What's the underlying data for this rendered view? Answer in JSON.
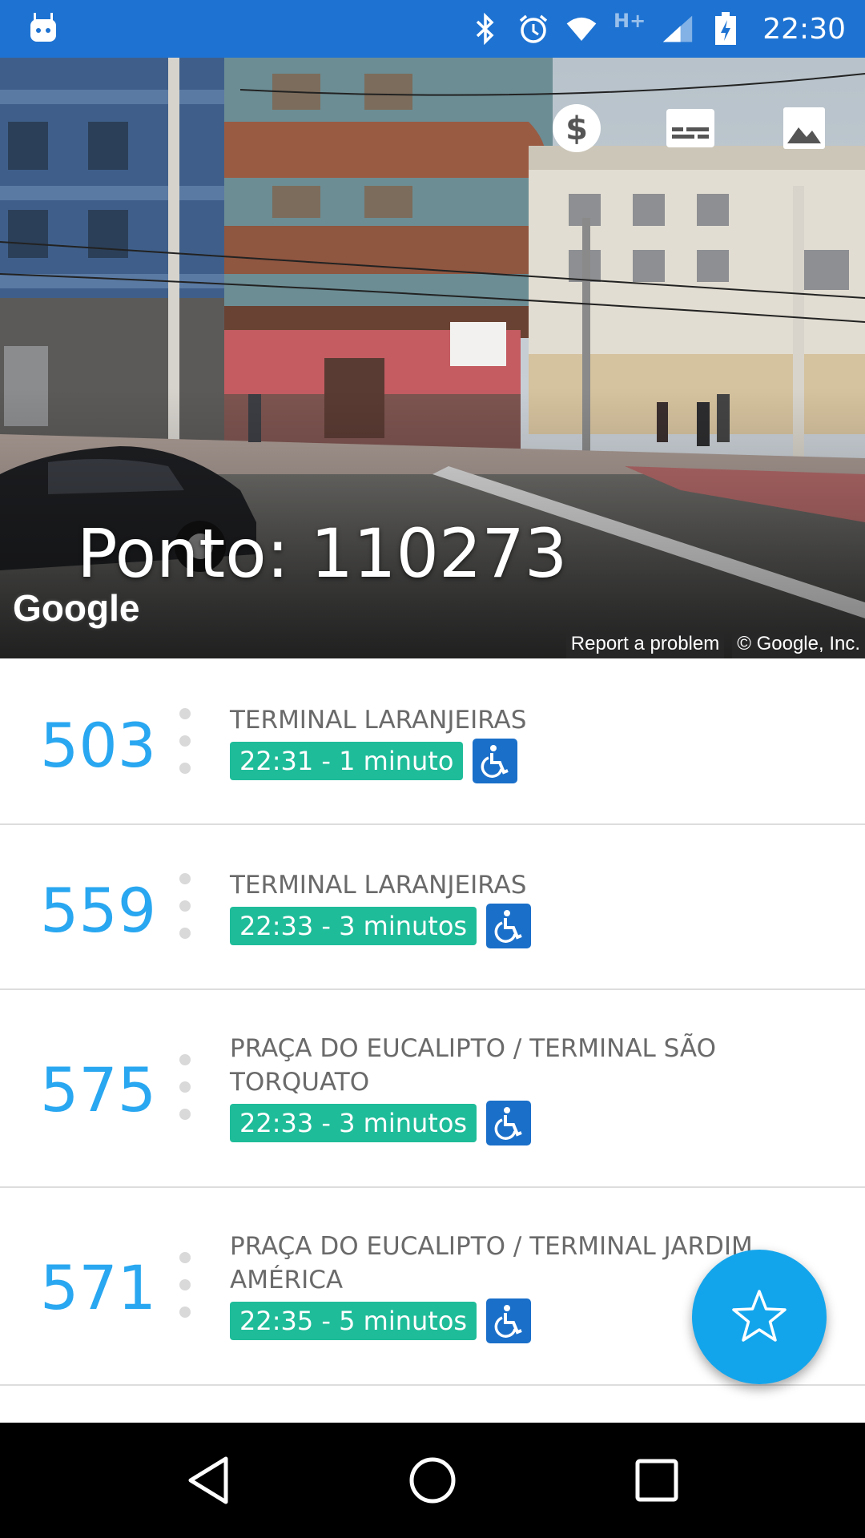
{
  "status_bar": {
    "time": "22:30",
    "network_label": "H+",
    "icons": [
      "android-icon",
      "bluetooth-icon",
      "alarm-icon",
      "wifi-icon",
      "signal-icon",
      "battery-charging-icon"
    ]
  },
  "header": {
    "stop_title": "Ponto: 110273",
    "google_logo": "Google",
    "report_label": "Report a problem",
    "copyright_label": "© Google, Inc.",
    "actions": [
      "fare-icon",
      "card-icon",
      "image-icon"
    ]
  },
  "arrivals": [
    {
      "line": "503",
      "destination": "TERMINAL LARANJEIRAS",
      "eta": "22:31 - 1 minuto",
      "accessible": true
    },
    {
      "line": "559",
      "destination": "TERMINAL LARANJEIRAS",
      "eta": "22:33 - 3 minutos",
      "accessible": true
    },
    {
      "line": "575",
      "destination": "PRAÇA DO EUCALIPTO / TERMINAL SÃO TORQUATO",
      "eta": "22:33 - 3 minutos",
      "accessible": true
    },
    {
      "line": "571",
      "destination": "PRAÇA DO EUCALIPTO / TERMINAL JARDIM AMÉRICA",
      "eta": "22:35 - 5 minutos",
      "accessible": true
    }
  ],
  "fab": {
    "icon": "star-outline-icon"
  },
  "colors": {
    "status_bar": "#1e73d2",
    "line_number": "#29a7f0",
    "eta_badge": "#1fbc99",
    "accessible_badge": "#1a6fc9",
    "fab": "#13a5ec"
  }
}
